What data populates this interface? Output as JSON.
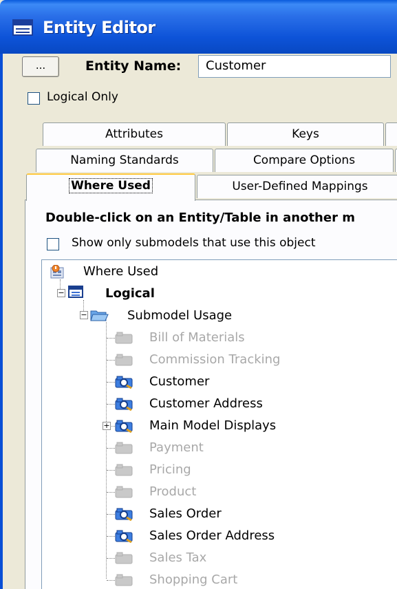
{
  "window": {
    "title": "Entity Editor"
  },
  "top": {
    "browse_label": "...",
    "entity_name_label": "Entity Name:",
    "entity_name_value": "Customer",
    "logical_only_label": "Logical Only"
  },
  "tabs": {
    "row1": [
      "Attributes",
      "Keys"
    ],
    "row2": [
      "Naming Standards",
      "Compare Options"
    ],
    "row3": [
      "Where Used",
      "User-Defined Mappings"
    ]
  },
  "panel": {
    "hint": "Double-click on an Entity/Table in another m",
    "show_submodels_label": "Show only submodels that use this object"
  },
  "tree": {
    "root": "Where Used",
    "logical": "Logical",
    "submodel_usage": "Submodel Usage",
    "items": [
      {
        "label": "Bill of Materials",
        "used": false
      },
      {
        "label": "Commission Tracking",
        "used": false
      },
      {
        "label": "Customer",
        "used": true
      },
      {
        "label": "Customer Address",
        "used": true
      },
      {
        "label": "Main Model Displays",
        "used": true,
        "expandable": true
      },
      {
        "label": "Payment",
        "used": false
      },
      {
        "label": "Pricing",
        "used": false
      },
      {
        "label": "Product",
        "used": false
      },
      {
        "label": "Sales Order",
        "used": true
      },
      {
        "label": "Sales Order Address",
        "used": true
      },
      {
        "label": "Sales Tax",
        "used": false
      },
      {
        "label": "Shopping Cart",
        "used": false
      }
    ]
  },
  "colors": {
    "titlebar": "#0d53d8",
    "tab_highlight": "#ffc83c",
    "disabled_text": "#a8a8a8"
  },
  "icons": [
    "window-icon",
    "where-used-icon",
    "logical-model-icon",
    "folder-open-icon",
    "submodel-icon"
  ]
}
